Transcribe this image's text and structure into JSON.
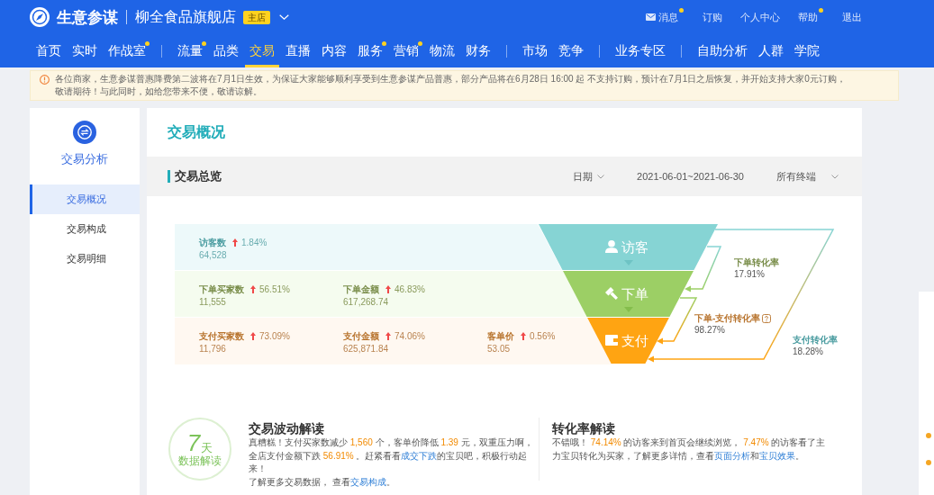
{
  "header": {
    "app_name": "生意参谋",
    "shop_name": "柳全食品旗舰店",
    "shop_badge": "主店",
    "links": [
      {
        "label": "消息",
        "kind": "mail",
        "dot": true
      },
      {
        "label": "订购",
        "kind": "plain",
        "dot": false
      },
      {
        "label": "个人中心",
        "kind": "plain",
        "dot": false
      },
      {
        "label": "帮助",
        "kind": "plain",
        "dot": true
      },
      {
        "label": "退出",
        "kind": "plain",
        "dot": false
      }
    ]
  },
  "nav": {
    "groups": [
      {
        "items": [
          {
            "label": "首页",
            "selected": false,
            "dot": false
          },
          {
            "label": "实时",
            "selected": false,
            "dot": false
          },
          {
            "label": "作战室",
            "selected": false,
            "dot": true
          }
        ]
      },
      {
        "items": [
          {
            "label": "流量",
            "selected": false,
            "dot": true
          },
          {
            "label": "品类",
            "selected": false,
            "dot": false
          },
          {
            "label": "交易",
            "selected": true,
            "dot": false
          },
          {
            "label": "直播",
            "selected": false,
            "dot": false
          },
          {
            "label": "内容",
            "selected": false,
            "dot": false
          },
          {
            "label": "服务",
            "selected": false,
            "dot": true
          },
          {
            "label": "营销",
            "selected": false,
            "dot": true
          },
          {
            "label": "物流",
            "selected": false,
            "dot": false
          },
          {
            "label": "财务",
            "selected": false,
            "dot": false
          }
        ]
      },
      {
        "items": [
          {
            "label": "市场",
            "selected": false,
            "dot": false
          },
          {
            "label": "竞争",
            "selected": false,
            "dot": false
          }
        ]
      },
      {
        "items": [
          {
            "label": "业务专区",
            "selected": false,
            "dot": false
          }
        ]
      },
      {
        "items": [
          {
            "label": "自助分析",
            "selected": false,
            "dot": false
          },
          {
            "label": "人群",
            "selected": false,
            "dot": false
          },
          {
            "label": "学院",
            "selected": false,
            "dot": false
          }
        ]
      }
    ]
  },
  "notice": {
    "text": "各位商家，生意参谋普惠降费第二波将在7月1日生效，为保证大家能够顺利享受到生意参谋产品普惠，部分产品将在6月28日 16:00 起 不支持订购，预计在7月1日之后恢复，并开始支持大家0元订购，敬请期待！与此同时，如给您带来不便，敬请谅解。"
  },
  "sidebar": {
    "title": "交易分析",
    "items": [
      {
        "label": "交易概况",
        "selected": true
      },
      {
        "label": "交易构成",
        "selected": false
      },
      {
        "label": "交易明细",
        "selected": false
      }
    ]
  },
  "page_title": "交易概况",
  "overview": {
    "title": "交易总览",
    "date_type": "日期",
    "date_range": "2021-06-01~2021-06-30",
    "terminal": "所有终端",
    "rows": [
      {
        "kind": "visit",
        "stage": "访客",
        "metrics": [
          {
            "label": "访客数",
            "rising": true,
            "change": "1.84%",
            "value": "64,528"
          }
        ]
      },
      {
        "kind": "order",
        "stage": "下单",
        "metrics": [
          {
            "label": "下单买家数",
            "rising": true,
            "change": "56.51%",
            "value": "11,555"
          },
          {
            "label": "下单金额",
            "rising": true,
            "change": "46.83%",
            "value": "617,268.74"
          }
        ]
      },
      {
        "kind": "pay",
        "stage": "支付",
        "metrics": [
          {
            "label": "支付买家数",
            "rising": true,
            "change": "73.09%",
            "value": "11,796"
          },
          {
            "label": "支付金额",
            "rising": true,
            "change": "74.06%",
            "value": "625,871.84"
          },
          {
            "label": "客单价",
            "rising": true,
            "change": "0.56%",
            "value": "53.05"
          }
        ]
      }
    ],
    "conversions": [
      {
        "label": "下单转化率",
        "value": "17.91%",
        "help": false
      },
      {
        "label": "下单-支付转化率",
        "value": "98.27%",
        "help": true
      },
      {
        "label": "支付转化率",
        "value": "18.28%",
        "help": false
      }
    ]
  },
  "insights": [
    {
      "title": "交易波动解读",
      "badge": {
        "number": "7",
        "unit": "天",
        "caption": "数据解读"
      },
      "paragraphs": [
        [
          {
            "kind": "text",
            "text": "真糟糕！支付买家数减少 "
          },
          {
            "kind": "number",
            "text": "1,560"
          },
          {
            "kind": "text",
            "text": " 个，客单价降低 "
          },
          {
            "kind": "number",
            "text": "1.39"
          },
          {
            "kind": "text",
            "text": " 元，双重压力啊，全店支付金额下跌 "
          },
          {
            "kind": "number",
            "text": "56.91%"
          },
          {
            "kind": "text",
            "text": " 。赶紧看看"
          },
          {
            "kind": "link",
            "text": "成交下跌"
          },
          {
            "kind": "text",
            "text": "的宝贝吧，积极行动起来！"
          }
        ],
        [
          {
            "kind": "text",
            "text": "了解更多交易数据， 查看"
          },
          {
            "kind": "link",
            "text": "交易构成"
          },
          {
            "kind": "text",
            "text": "。"
          }
        ]
      ]
    },
    {
      "title": "转化率解读",
      "paragraphs": [
        [
          {
            "kind": "text",
            "text": "不错哦！ "
          },
          {
            "kind": "number",
            "text": "74.14%"
          },
          {
            "kind": "text",
            "text": " 的访客来到首页会继续浏览， "
          },
          {
            "kind": "number",
            "text": "7.47%"
          },
          {
            "kind": "text",
            "text": " 的访客看了主力宝贝转化为买家，了解更多详情，查看"
          },
          {
            "kind": "link",
            "text": "页面分析"
          },
          {
            "kind": "text",
            "text": "和"
          },
          {
            "kind": "link",
            "text": "宝贝效果"
          },
          {
            "kind": "text",
            "text": "。"
          }
        ]
      ]
    }
  ]
}
